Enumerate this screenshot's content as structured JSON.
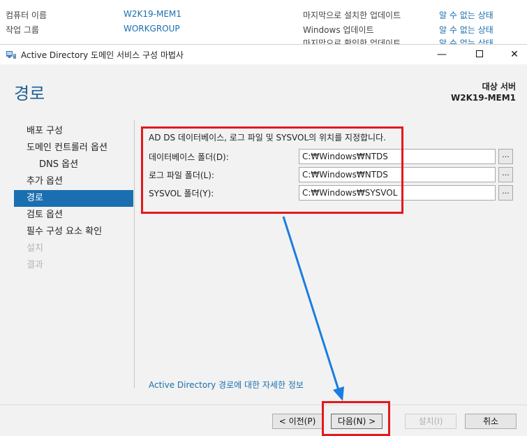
{
  "background": {
    "rows": [
      {
        "label": "컴퓨터 이름",
        "value": "W2K19-MEM1",
        "label2": "마지막으로 설치한 업데이트",
        "value2": "알 수 없는 상태"
      },
      {
        "label": "작업 그룹",
        "value": "WORKGROUP",
        "label2": "Windows 업데이트",
        "value2": "알 수 없는 상태"
      },
      {
        "label": "",
        "value": "",
        "label2": "마지막으로 확인한 업데이트",
        "value2": "알 수 없는 상태"
      }
    ]
  },
  "window": {
    "title": "Active Directory 도메인 서비스 구성 마법사",
    "minimize": "—",
    "close": "✕"
  },
  "page": {
    "title": "경로",
    "target_label": "대상 서버",
    "target_server": "W2K19-MEM1"
  },
  "nav": {
    "items": [
      {
        "label": "배포 구성",
        "state": "normal"
      },
      {
        "label": "도메인 컨트롤러 옵션",
        "state": "normal"
      },
      {
        "label": "DNS 옵션",
        "state": "sub"
      },
      {
        "label": "추가 옵션",
        "state": "normal"
      },
      {
        "label": "경로",
        "state": "selected"
      },
      {
        "label": "검토 옵션",
        "state": "normal"
      },
      {
        "label": "필수 구성 요소 확인",
        "state": "normal"
      },
      {
        "label": "설치",
        "state": "disabled"
      },
      {
        "label": "결과",
        "state": "disabled"
      }
    ]
  },
  "content": {
    "intro": "AD DS 데이터베이스, 로그 파일 및 SYSVOL의 위치를 지정합니다.",
    "fields": [
      {
        "label": "데이터베이스 폴더(D):",
        "value": "C:₩Windows₩NTDS"
      },
      {
        "label": "로그 파일 폴더(L):",
        "value": "C:₩Windows₩NTDS"
      },
      {
        "label": "SYSVOL 폴더(Y):",
        "value": "C:₩Windows₩SYSVOL"
      }
    ],
    "browse_label": "...",
    "more_link": "Active Directory 경로에 대한 자세한 정보"
  },
  "footer": {
    "prev": "< 이전(P)",
    "next": "다음(N) >",
    "install": "설치(I)",
    "cancel": "취소"
  },
  "colors": {
    "accent": "#1a6fb0",
    "highlight": "#e3191c",
    "annotation_arrow": "#1a7de0"
  }
}
